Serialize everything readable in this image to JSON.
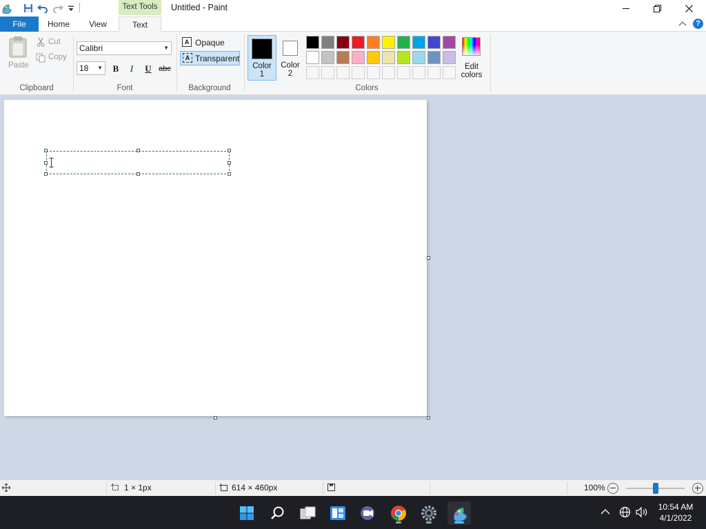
{
  "window": {
    "title": "Untitled - Paint",
    "contextual_tab": "Text Tools"
  },
  "tabs": [
    "File",
    "Home",
    "View",
    "Text"
  ],
  "clipboard": {
    "paste": "Paste",
    "cut": "Cut",
    "copy": "Copy",
    "label": "Clipboard"
  },
  "font": {
    "family": "Calibri",
    "size": "18",
    "bold": "B",
    "italic": "I",
    "underline": "U",
    "strike": "abc",
    "label": "Font"
  },
  "background": {
    "opaque": "Opaque",
    "transparent": "Transparent",
    "label": "Background"
  },
  "colors": {
    "color1_label": "Color",
    "color1_num": "1",
    "color2_label": "Color",
    "color2_num": "2",
    "color1_value": "#000000",
    "color2_value": "#ffffff",
    "edit_label": "Edit",
    "edit_label2": "colors",
    "label": "Colors",
    "palette_row1": [
      "#000000",
      "#7f7f7f",
      "#880015",
      "#ed1c24",
      "#ff7f27",
      "#fff200",
      "#22b14c",
      "#00a2e8",
      "#3f48cc",
      "#a349a4"
    ],
    "palette_row2": [
      "#ffffff",
      "#c3c3c3",
      "#b97a57",
      "#ffaec9",
      "#ffc90e",
      "#efe4b0",
      "#b5e61d",
      "#99d9ea",
      "#7092be",
      "#c8bfe7"
    ],
    "palette_row3": [
      "#f5f6f7",
      "#f5f6f7",
      "#f5f6f7",
      "#f5f6f7",
      "#f5f6f7",
      "#f5f6f7",
      "#f5f6f7",
      "#f5f6f7",
      "#f5f6f7",
      "#f5f6f7"
    ]
  },
  "status": {
    "selection": "1 × 1px",
    "canvas_size": "614 × 460px",
    "zoom": "100%",
    "zoom_level": 0.5
  },
  "taskbar": {
    "time": "10:54 AM",
    "date": "4/1/2022"
  }
}
